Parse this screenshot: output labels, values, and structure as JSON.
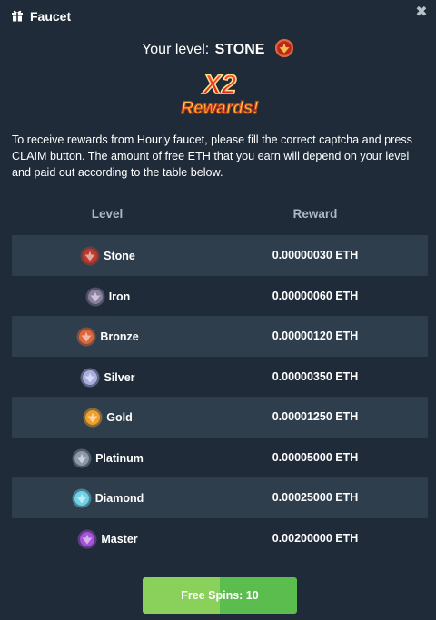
{
  "header": {
    "title": "Faucet",
    "gift_icon": "gift-icon",
    "close_icon": "close-icon"
  },
  "level": {
    "prefix": "Your level:",
    "name": "STONE",
    "badge_icon": "stone-badge-icon"
  },
  "promo": {
    "line1": "X2",
    "line2": "Rewards!"
  },
  "description": "To receive rewards from Hourly faucet, please fill the correct captcha and press CLAIM button. The amount of free ETH that you earn will depend on your level and paid out according to the table below.",
  "table": {
    "headers": {
      "level": "Level",
      "reward": "Reward"
    },
    "rows": [
      {
        "level": "Stone",
        "reward": "0.00000030 ETH",
        "icon": "stone-badge-icon",
        "color": "#c0392b"
      },
      {
        "level": "Iron",
        "reward": "0.00000060 ETH",
        "icon": "iron-badge-icon",
        "color": "#8a7fa0"
      },
      {
        "level": "Bronze",
        "reward": "0.00000120 ETH",
        "icon": "bronze-badge-icon",
        "color": "#e0653a"
      },
      {
        "level": "Silver",
        "reward": "0.00000350 ETH",
        "icon": "silver-badge-icon",
        "color": "#a9aee0"
      },
      {
        "level": "Gold",
        "reward": "0.00001250 ETH",
        "icon": "gold-badge-icon",
        "color": "#f0a02a"
      },
      {
        "level": "Platinum",
        "reward": "0.00005000 ETH",
        "icon": "platinum-badge-icon",
        "color": "#8c97a8"
      },
      {
        "level": "Diamond",
        "reward": "0.00025000 ETH",
        "icon": "diamond-badge-icon",
        "color": "#6fd3e6"
      },
      {
        "level": "Master",
        "reward": "0.00200000 ETH",
        "icon": "master-badge-icon",
        "color": "#a653d9"
      }
    ]
  },
  "button": {
    "label": "Free Spins: 10"
  }
}
